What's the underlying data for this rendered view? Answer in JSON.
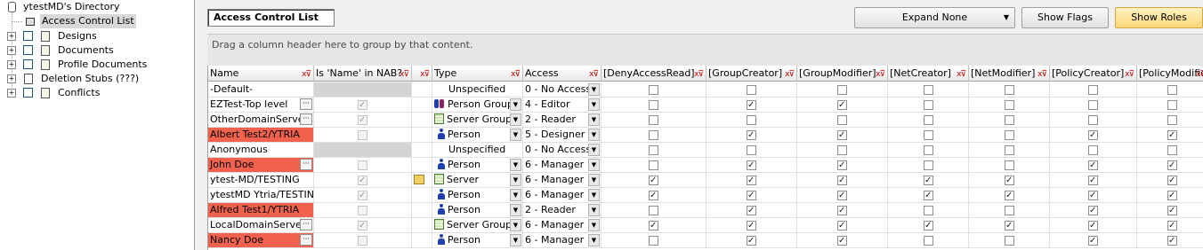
{
  "tree": {
    "root": "ytestMD's Directory",
    "selected": "Access Control List",
    "items": [
      "Designs",
      "Documents",
      "Profile Documents",
      "Deletion Stubs  (???)",
      "Conflicts"
    ]
  },
  "toolbar": {
    "title": "Access Control List",
    "expand_label": "Expand None",
    "show_flags": "Show Flags",
    "show_roles": "Show Roles"
  },
  "groupbar": "Drag a column header here to group by that content.",
  "columns": [
    "Name",
    "Is 'Name' in NAB?",
    "",
    "Type",
    "Access",
    "[DenyAccessRead]",
    "[GroupCreator]",
    "[GroupModifier]",
    "[NetCreator]",
    "[NetModifier]",
    "[PolicyCreator]",
    "[PolicyModifier]"
  ],
  "rows": [
    {
      "name": "-Default-",
      "nab": null,
      "role": false,
      "type": "Unspecified",
      "type_icon": "none",
      "access": "0 - No Access",
      "flags": [
        0,
        0,
        0,
        0,
        0,
        0,
        0
      ],
      "red": false,
      "grey": true,
      "ellipsis": false
    },
    {
      "name": "EZTest-Top level",
      "nab": true,
      "role": false,
      "type": "Person Group",
      "type_icon": "person-group-icon",
      "access": "4 - Editor",
      "flags": [
        0,
        1,
        1,
        0,
        0,
        0,
        0
      ],
      "red": false,
      "grey": false,
      "ellipsis": true
    },
    {
      "name": "OtherDomainServers",
      "nab": true,
      "role": false,
      "type": "Server Group",
      "type_icon": "server-group-icon",
      "access": "2 - Reader",
      "flags": [
        0,
        0,
        0,
        0,
        0,
        0,
        0
      ],
      "red": false,
      "grey": false,
      "ellipsis": true
    },
    {
      "name": "Albert Test2/YTRIA",
      "nab": false,
      "role": false,
      "type": "Person",
      "type_icon": "person-icon",
      "access": "5 - Designer",
      "flags": [
        0,
        1,
        1,
        0,
        0,
        1,
        1
      ],
      "red": true,
      "grey": false,
      "ellipsis": false
    },
    {
      "name": "Anonymous",
      "nab": null,
      "role": false,
      "type": "Unspecified",
      "type_icon": "none",
      "access": "0 - No Access",
      "flags": [
        0,
        0,
        0,
        0,
        0,
        0,
        0
      ],
      "red": false,
      "grey": true,
      "ellipsis": false
    },
    {
      "name": "John Doe",
      "nab": false,
      "role": false,
      "type": "Person",
      "type_icon": "person-icon",
      "access": "6 - Manager",
      "flags": [
        0,
        1,
        1,
        0,
        0,
        1,
        1
      ],
      "red": true,
      "grey": false,
      "ellipsis": true
    },
    {
      "name": "ytest-MD/TESTING",
      "nab": true,
      "role": true,
      "type": "Server",
      "type_icon": "server-icon",
      "access": "6 - Manager",
      "flags": [
        1,
        1,
        1,
        1,
        1,
        1,
        1
      ],
      "red": false,
      "grey": false,
      "ellipsis": false
    },
    {
      "name": "ytestMD Ytria/TESTING",
      "nab": true,
      "role": false,
      "type": "Person",
      "type_icon": "person-icon",
      "access": "6 - Manager",
      "flags": [
        1,
        1,
        1,
        1,
        1,
        1,
        1
      ],
      "red": false,
      "grey": false,
      "ellipsis": false
    },
    {
      "name": "Alfred Test1/YTRIA",
      "nab": false,
      "role": false,
      "type": "Person",
      "type_icon": "person-icon",
      "access": "2 - Reader",
      "flags": [
        0,
        1,
        1,
        0,
        0,
        1,
        1
      ],
      "red": true,
      "grey": false,
      "ellipsis": false
    },
    {
      "name": "LocalDomainServers",
      "nab": true,
      "role": false,
      "type": "Server Group",
      "type_icon": "server-group-icon",
      "access": "6 - Manager",
      "flags": [
        1,
        1,
        1,
        1,
        1,
        1,
        1
      ],
      "red": false,
      "grey": false,
      "ellipsis": true
    },
    {
      "name": "Nancy Doe",
      "nab": false,
      "role": false,
      "type": "Person",
      "type_icon": "person-icon",
      "access": "6 - Manager",
      "flags": [
        0,
        1,
        1,
        0,
        0,
        1,
        1
      ],
      "red": true,
      "grey": false,
      "ellipsis": true
    }
  ]
}
